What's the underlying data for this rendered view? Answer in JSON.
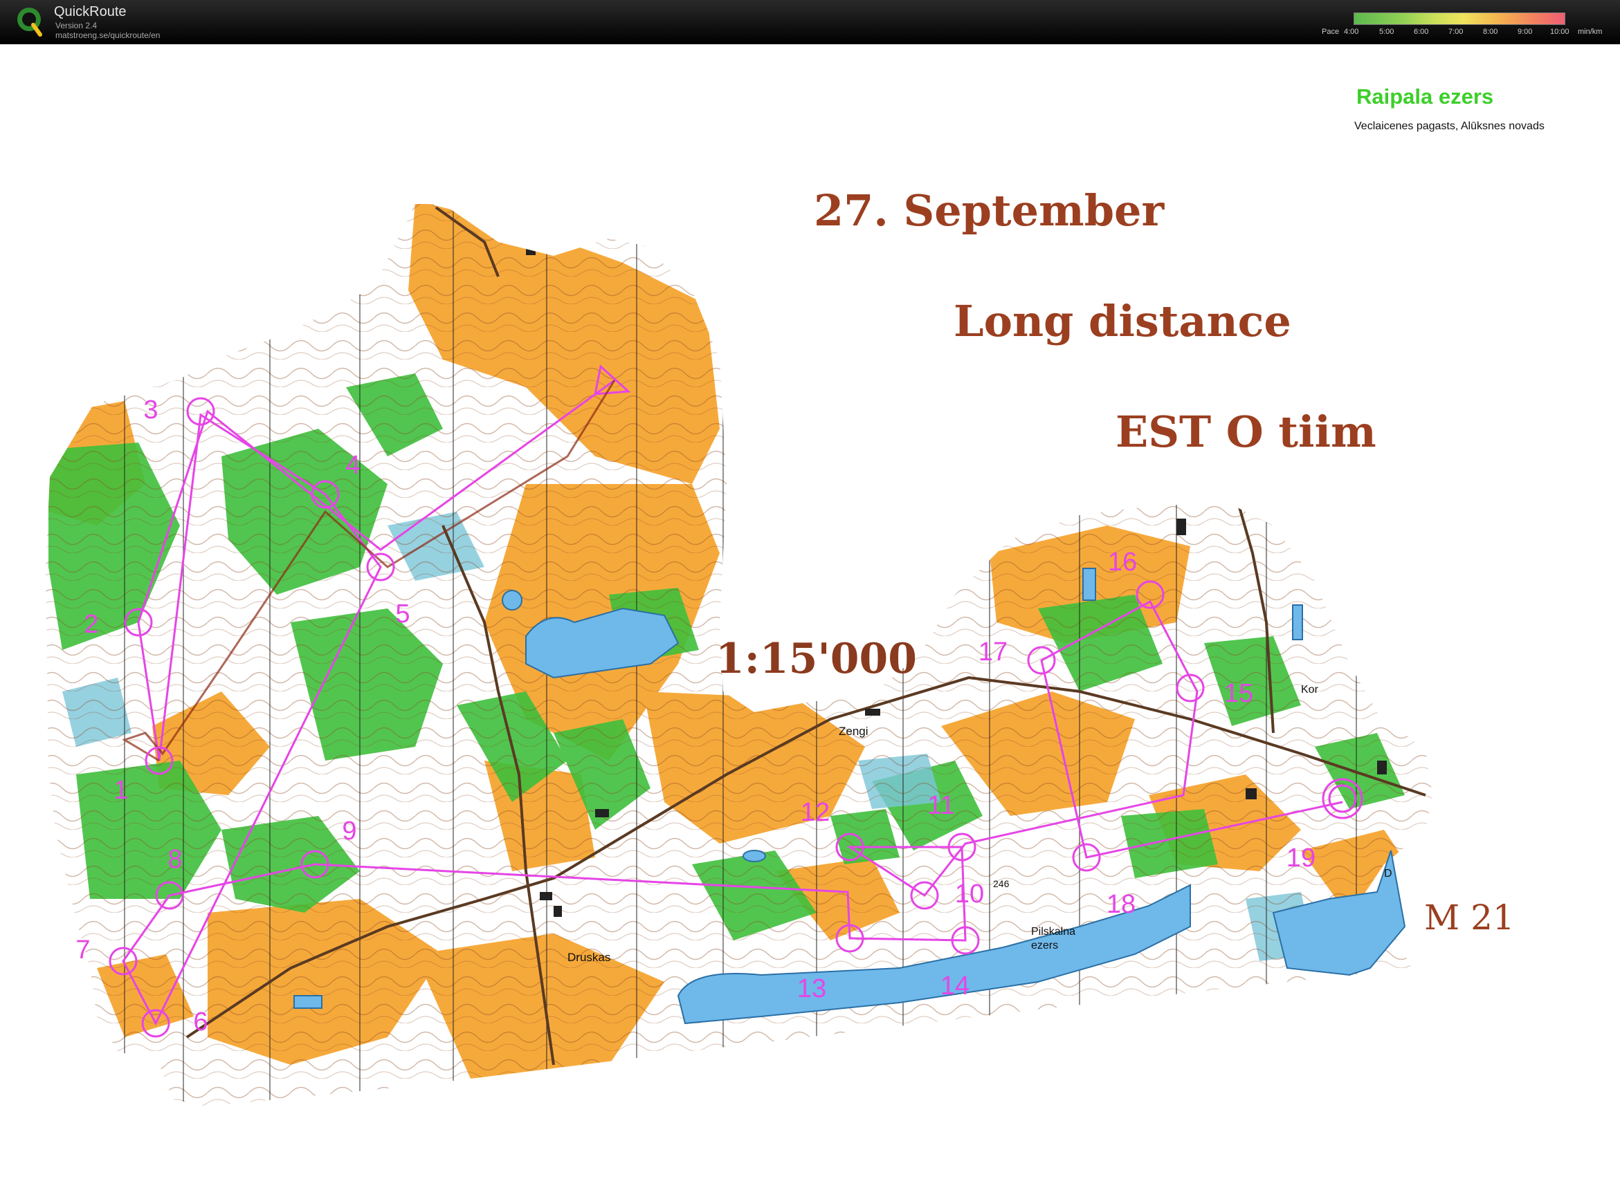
{
  "app": {
    "name": "QuickRoute",
    "version": "Version 2.4",
    "url": "matstroeng.se/quickroute/en"
  },
  "pace_scale": {
    "label": "Pace",
    "ticks": [
      "4:00",
      "5:00",
      "6:00",
      "7:00",
      "8:00",
      "9:00",
      "10:00"
    ],
    "unit": "min/km"
  },
  "map_info": {
    "area_name": "Raipala ezers",
    "location": "Veclaicenes pagasts, Alūksnes novads",
    "title_color": "#3ccf2a"
  },
  "overlay": {
    "date": "27. September",
    "event": "Long distance",
    "club": "EST O tiim",
    "scale": "1:15'000",
    "class": "M 21",
    "text_color": "#9b3f20"
  },
  "map_labels": {
    "village_druskas": "Druskas",
    "farm_zengi": "Zengi",
    "lake_pilskalna": "Pilskalna",
    "lake_ezers": "ezers",
    "spot_height": "246",
    "edge_kor": "Kor",
    "edge_d": "D"
  },
  "course": {
    "color": "#e645e6",
    "controls": [
      {
        "label": "1"
      },
      {
        "label": "2"
      },
      {
        "label": "3"
      },
      {
        "label": "4"
      },
      {
        "label": "5"
      },
      {
        "label": "6"
      },
      {
        "label": "7"
      },
      {
        "label": "8"
      },
      {
        "label": "9"
      },
      {
        "label": "10"
      },
      {
        "label": "11"
      },
      {
        "label": "12"
      },
      {
        "label": "13"
      },
      {
        "label": "14"
      },
      {
        "label": "15"
      },
      {
        "label": "16"
      },
      {
        "label": "17"
      },
      {
        "label": "18"
      },
      {
        "label": "19"
      }
    ]
  },
  "colors": {
    "forest_runnable": "#ffffff",
    "open_land": "#f6a93b",
    "vegetation": "#3fbf3c",
    "water": "#6eb8ea",
    "contour": "#8a4a22"
  }
}
